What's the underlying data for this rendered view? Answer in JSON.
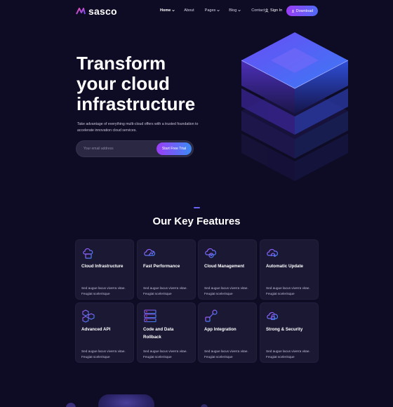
{
  "brand": {
    "name": "sasco",
    "accent": "#9b3cf6",
    "accent2": "#4f6cf5"
  },
  "nav": {
    "links": [
      {
        "label": "Home",
        "dropdown": true,
        "active": true
      },
      {
        "label": "About",
        "dropdown": false,
        "active": false
      },
      {
        "label": "Pages",
        "dropdown": true,
        "active": false
      },
      {
        "label": "Blog",
        "dropdown": true,
        "active": false
      },
      {
        "label": "Contact",
        "dropdown": false,
        "active": false
      }
    ],
    "signin_label": "Sign In",
    "download_label": "Download"
  },
  "hero": {
    "title_lines": [
      "Transform",
      "your cloud",
      "infrastructure"
    ],
    "subtitle": "Take advantage of everything multi-cloud offers with a trusted foundation to accelerate innovation cloud services.",
    "email_placeholder": "Your email address",
    "cta_label": "Start Free Trial"
  },
  "features": {
    "title": "Our Key Features",
    "items": [
      {
        "title": "Cloud Infrastructure",
        "desc": "Sed augue lacus viverra vitae. Feugiat scelerisque",
        "icon": "cloud-server-icon"
      },
      {
        "title": "Fast Performance",
        "desc": "Sed augue lacus viverra vitae. Feugiat scelerisque",
        "icon": "cloud-speed-icon"
      },
      {
        "title": "Cloud Management",
        "desc": "Sed augue lacus viverra vitae. Feugiat scelerisque",
        "icon": "cloud-gear-icon"
      },
      {
        "title": "Automatic Update",
        "desc": "Sed augue lacus viverra vitae. Feugiat scelerisque",
        "icon": "cloud-refresh-icon"
      },
      {
        "title": "Advanced API",
        "desc": "Sed augue lacus viverra vitae. Feugiat scelerisque",
        "icon": "hexagon-network-icon"
      },
      {
        "title": "Code and Data Rollback",
        "desc": "Sed augue lacus viverra vitae. Feugiat scelerisque",
        "icon": "server-stack-icon"
      },
      {
        "title": "App Integration",
        "desc": "Sed augue lacus viverra vitae. Feugiat scelerisque",
        "icon": "node-connect-icon"
      },
      {
        "title": "Strong & Security",
        "desc": "Sed augue lacus viverra vitae. Feugiat scelerisque",
        "icon": "cloud-lock-icon"
      }
    ]
  }
}
